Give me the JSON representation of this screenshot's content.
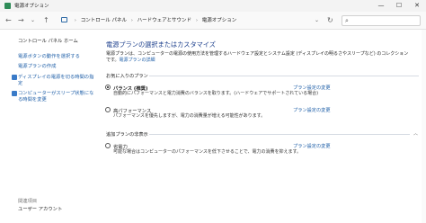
{
  "window": {
    "title": "電源オプション",
    "minimize": "—",
    "maximize": "☐",
    "close": "✕"
  },
  "address": {
    "crumbs": [
      "コントロール パネル",
      "ハードウェアとサウンド",
      "電源オプション"
    ],
    "separator": "›",
    "back": "←",
    "forward": "→",
    "recent": "⌄",
    "up": "↑",
    "dropdown": "⌄",
    "refresh": "↻",
    "search_icon": "⌕"
  },
  "sidebar": {
    "home": "コントロール パネル ホーム",
    "links": [
      "電源ボタンの動作を選択する",
      "電源プランの作成",
      "ディスプレイの電源を切る時間の指定",
      "コンピューターがスリープ状態になる時間を変更"
    ],
    "related_title": "関連項目",
    "related_links": [
      "ユーザー アカウント"
    ]
  },
  "main": {
    "heading": "電源プランの選択またはカスタマイズ",
    "description": "電源プランは、コンピューターの電源の使用方法を管理するハードウェア設定とシステム設定 (ディスプレイの明るさやスリープなど) のコレクションです。",
    "description_link": "電源プランの詳細",
    "preferred_label": "お気に入りのプラン",
    "additional_label": "追加プランの非表示",
    "plans": [
      {
        "name": "バランス (推奨)",
        "desc": "自動的にパフォーマンスと電力消費のバランスを取ります。(ハードウェアでサポートされている場合)",
        "link": "プラン設定の変更",
        "selected": true
      },
      {
        "name": "高パフォーマンス",
        "desc": "パフォーマンスを優先しますが、電力の消費量が増える可能性があります。",
        "link": "プラン設定の変更",
        "selected": false
      }
    ],
    "hidden_plans": [
      {
        "name": "省電力",
        "desc": "可能な場合はコンピューターのパフォーマンスを低下させることで、電力の消費を抑えます。",
        "link": "プラン設定の変更",
        "selected": false
      }
    ],
    "collapse_icon": "︿"
  }
}
